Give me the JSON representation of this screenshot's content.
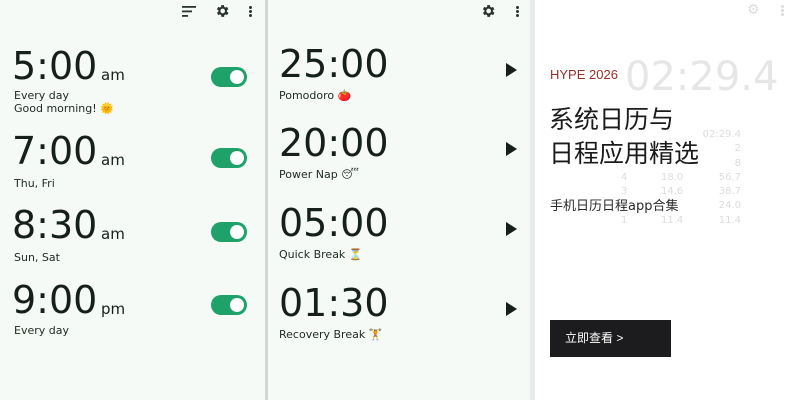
{
  "alarm_panel": {
    "toolbar": {
      "sort_icon": "sort-icon",
      "settings_icon": "gear-icon",
      "menu_icon": "more-vert-icon"
    },
    "alarms": [
      {
        "time": "5:00",
        "period": "am",
        "repeat": "Every day",
        "note": "Good morning! 🌞",
        "enabled": true
      },
      {
        "time": "7:00",
        "period": "am",
        "repeat": "Thu, Fri",
        "note": "",
        "enabled": true
      },
      {
        "time": "8:30",
        "period": "am",
        "repeat": "Sun, Sat",
        "note": "",
        "enabled": true
      },
      {
        "time": "9:00",
        "period": "pm",
        "repeat": "Every day",
        "note": "",
        "enabled": true
      }
    ]
  },
  "timer_panel": {
    "toolbar": {
      "settings_icon": "gear-icon",
      "menu_icon": "more-vert-icon"
    },
    "timers": [
      {
        "duration": "25:00",
        "label": "Pomodoro 🍅"
      },
      {
        "duration": "20:00",
        "label": "Power Nap 😴"
      },
      {
        "duration": "05:00",
        "label": "Quick Break ⏳"
      },
      {
        "duration": "01:30",
        "label": "Recovery Break 🏋"
      }
    ]
  },
  "promo": {
    "kicker": "HYPE 2026",
    "title_line1": "系统日历与",
    "title_line2": "日程应用精选",
    "subtitle": "手机日历日程app合集",
    "button_label": "立即查看 >",
    "background_stopwatch": {
      "time": "02:29.4",
      "laps": [
        [
          "",
          "",
          "02:29.4"
        ],
        [
          "",
          "",
          "2"
        ],
        [
          "",
          "",
          "8"
        ],
        [
          "4",
          "18.0",
          "56.7"
        ],
        [
          "3",
          "14.6",
          "38.7"
        ],
        [
          "2",
          "",
          "24.0"
        ],
        [
          "1",
          "11.4",
          "11.4"
        ]
      ]
    }
  },
  "colors": {
    "toggle_on": "#1fa16a",
    "kicker": "#9c2d28",
    "button_bg": "#1c1c1e",
    "panel_bg": "#f6faf6"
  }
}
